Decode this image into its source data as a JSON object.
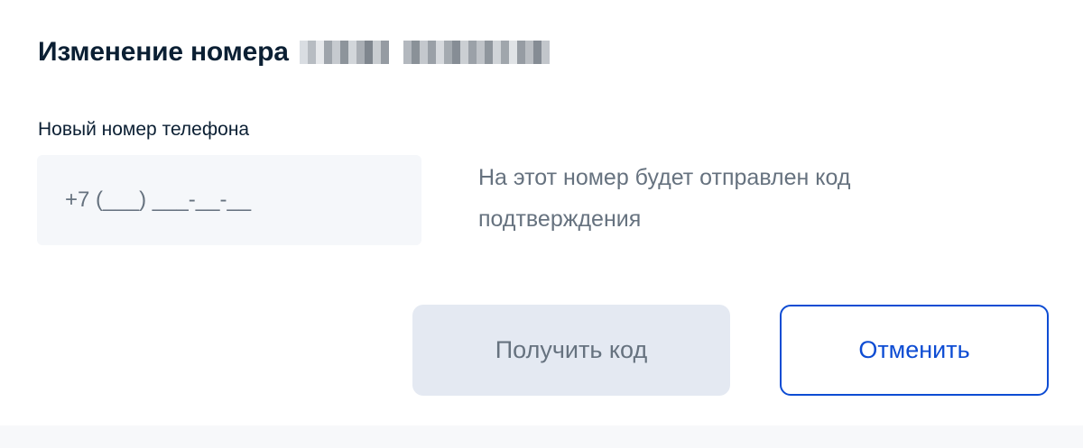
{
  "dialog": {
    "title": "Изменение номера",
    "current_number_redacted": true
  },
  "phone_field": {
    "label": "Новый номер телефона",
    "placeholder": "+7 (___) ___-__-__",
    "value": ""
  },
  "hint": {
    "text": "На этот номер будет отправлен код подтверждения"
  },
  "buttons": {
    "get_code_label": "Получить код",
    "get_code_enabled": false,
    "cancel_label": "Отменить"
  },
  "colors": {
    "text_primary": "#0b1f33",
    "text_secondary": "#66727f",
    "accent": "#0d4cd3",
    "input_bg": "#f5f7fa",
    "disabled_button_bg": "#e4e9f2"
  }
}
